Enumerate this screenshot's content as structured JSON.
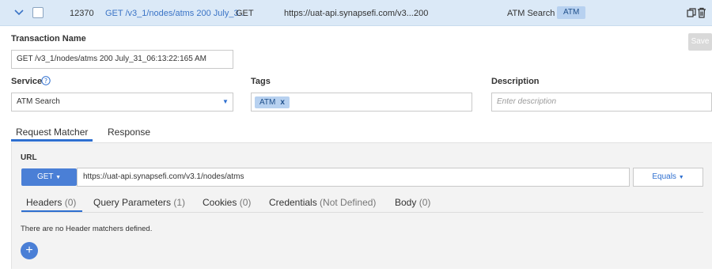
{
  "row": {
    "id": "12370",
    "name": "GET /v3_1/nodes/atms 200 July_3...",
    "method": "GET",
    "url": "https://uat-api.synapsefi.com/v3....",
    "status": "200",
    "service": "ATM Search",
    "tag": "ATM",
    "icons": [
      "chevron-down-icon",
      "checkbox",
      "copy-icon",
      "trash-icon"
    ]
  },
  "form": {
    "transaction_name_label": "Transaction Name",
    "transaction_name_value": "GET /v3_1/nodes/atms 200 July_31_06:13:22:165 AM",
    "save_label": "Save",
    "service_label": "Service",
    "service_value": "ATM Search",
    "tags_label": "Tags",
    "tag_value": "ATM",
    "tag_remove": "x",
    "description_label": "Description",
    "description_placeholder": "Enter description"
  },
  "tabs": {
    "request_matcher": "Request Matcher",
    "response": "Response"
  },
  "matcher": {
    "url_label": "URL",
    "method": "GET",
    "url_value": "https://uat-api.synapsefi.com/v3.1/nodes/atms",
    "match_type": "Equals",
    "subtabs": [
      {
        "label": "Headers",
        "count": "(0)"
      },
      {
        "label": "Query Parameters",
        "count": "(1)"
      },
      {
        "label": "Cookies",
        "count": "(0)"
      },
      {
        "label": "Credentials",
        "count": "(Not Defined)"
      },
      {
        "label": "Body",
        "count": "(0)"
      }
    ],
    "empty_message": "There are no Header matchers defined.",
    "add_label": "+"
  },
  "colors": {
    "accent": "#2e6fd0",
    "header_bg": "#dbe9f7",
    "tag_bg": "#b7d1f0",
    "panel_bg": "#f3f3f3"
  }
}
